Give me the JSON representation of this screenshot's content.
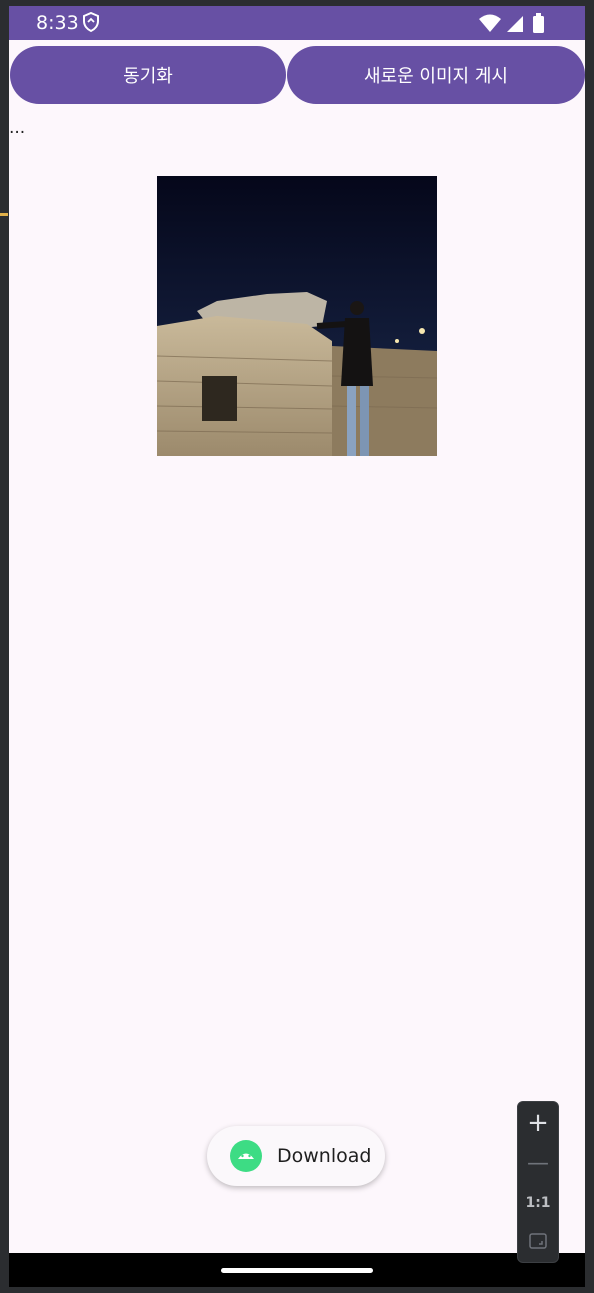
{
  "status_bar": {
    "time": "8:33",
    "icons": [
      "shield-icon",
      "wifi-icon",
      "signal-icon",
      "battery-icon"
    ],
    "background": "#6750a4"
  },
  "actions": {
    "sync_label": "동기화",
    "post_label": "새로운 이미지 게시"
  },
  "content": {
    "ellipsis": "...",
    "image_description": "Person leaning on a stone fortress wall at night"
  },
  "download_pill": {
    "icon": "android-icon",
    "label": "Download"
  },
  "zoom_controls": {
    "zoom_in": "+",
    "zoom_out": "—",
    "actual_size": "1:1",
    "fit_icon": "fit-screen-icon"
  },
  "colors": {
    "primary": "#6750a4",
    "surface": "#fdf7fc",
    "android_green": "#3ddc84"
  }
}
